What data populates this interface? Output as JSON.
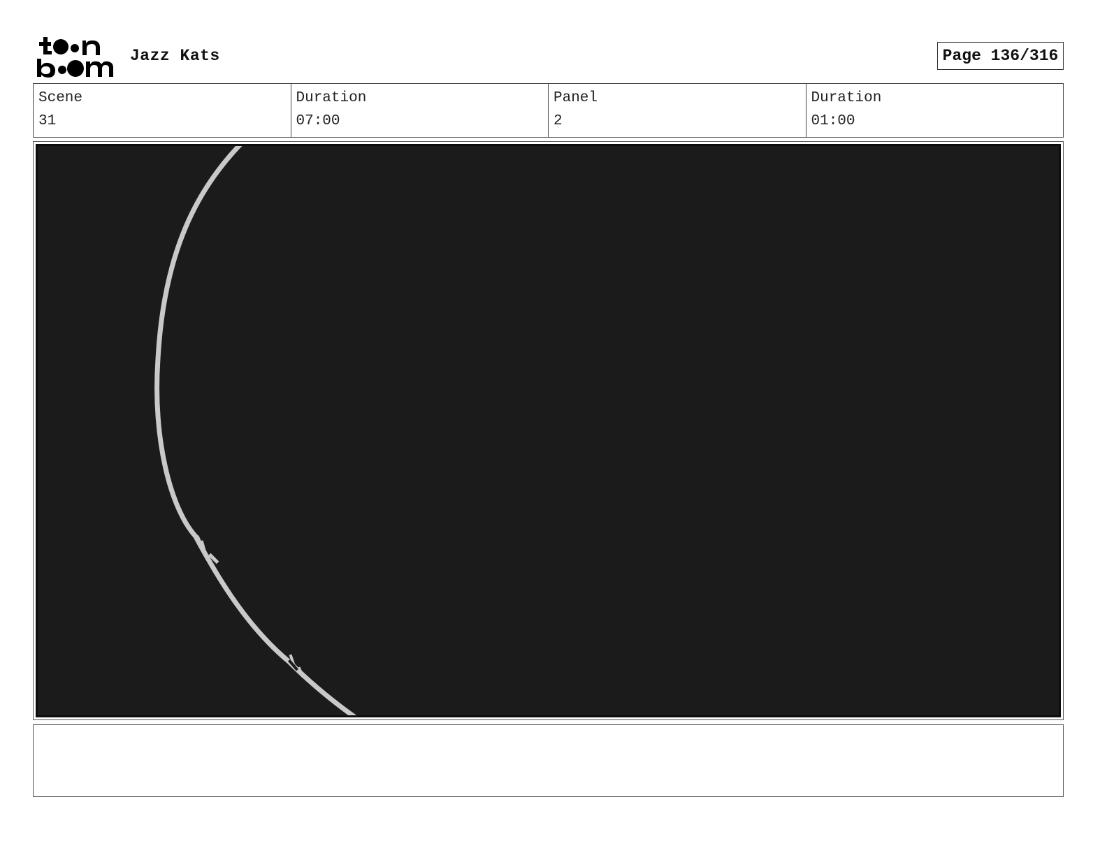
{
  "header": {
    "logo_text": "toon boom",
    "project_title": "Jazz Kats",
    "page_label": "Page 136/316"
  },
  "info": {
    "scene_label": "Scene",
    "scene_value": "31",
    "scene_duration_label": "Duration",
    "scene_duration_value": "07:00",
    "panel_label": "Panel",
    "panel_value": "2",
    "panel_duration_label": "Duration",
    "panel_duration_value": "01:00"
  },
  "panel": {
    "background_color": "#1b1b1b",
    "stroke_color": "#c9c9c9"
  },
  "notes": {
    "text": ""
  }
}
